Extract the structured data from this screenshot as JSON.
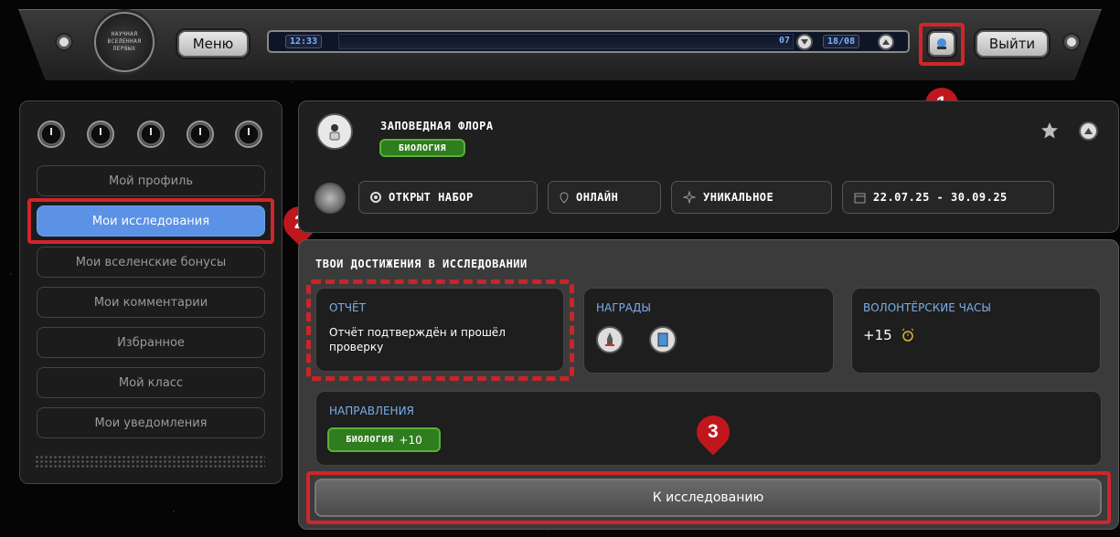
{
  "topbar": {
    "menu_label": "Меню",
    "logout_label": "Выйти",
    "logo_lines": [
      "НАУЧНАЯ",
      "ВСЕЛЕННАЯ",
      "ПЕРВЫХ"
    ],
    "ticker_left": "12:33",
    "ticker_right_prefix": "07",
    "ticker_right_box": "18/08"
  },
  "markers": [
    "1",
    "2",
    "3"
  ],
  "sidebar": {
    "items": [
      {
        "label": "Мой профиль"
      },
      {
        "label": "Мои исследования"
      },
      {
        "label": "Мои вселенские бонусы"
      },
      {
        "label": "Мои комментарии"
      },
      {
        "label": "Избранное"
      },
      {
        "label": "Мой класс"
      },
      {
        "label": "Мои уведомления"
      }
    ]
  },
  "project": {
    "title": "Заповедная флора",
    "tag": "биология",
    "chips": [
      {
        "icon": "radio-dot-icon",
        "label": "открыт набор"
      },
      {
        "icon": "location-pin-icon",
        "label": "онлайн"
      },
      {
        "icon": "sparkle-icon",
        "label": "уникальное"
      },
      {
        "icon": "calendar-icon",
        "label": "22.07.25 - 30.09.25"
      }
    ]
  },
  "achievements": {
    "heading": "твои достижения в исследовании",
    "report_title": "ОТЧЁТ",
    "report_text": "Отчёт подтверждён и прошёл проверку",
    "awards_title": "НАГРАДЫ",
    "volunteer_title": "ВОЛОНТЁРСКИЕ ЧАСЫ",
    "volunteer_value": "+15",
    "directions_title": "НАПРАВЛЕНИЯ",
    "direction_tag": "биология",
    "direction_points": "+10",
    "cta_label": "К исследованию"
  },
  "colors": {
    "accent_blue": "#5b92e5",
    "highlight_red": "#d0262a",
    "tag_green": "#2f7d1e",
    "subtitle_blue": "#7aaeea"
  }
}
